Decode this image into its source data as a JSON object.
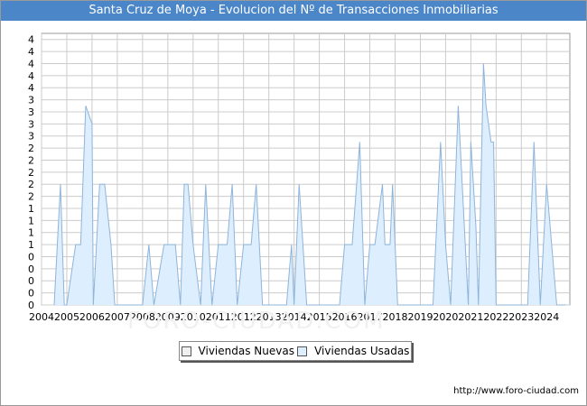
{
  "title": "Santa Cruz de Moya - Evolucion del Nº de Transacciones Inmobiliarias",
  "source": "http://www.foro-ciudad.com",
  "watermark": "FORO-CIUDAD.COM",
  "legend": {
    "nuevas_label": "Viviendas Nuevas",
    "usadas_label": "Viviendas Usadas"
  },
  "colors": {
    "title_bg": "#4a86c8",
    "nuevas_fill": "#f0f0f0",
    "usadas_fill": "#ddeeff",
    "usadas_stroke": "#8fb4d9",
    "grid": "#cccccc"
  },
  "chart_data": {
    "type": "area",
    "title": "Santa Cruz de Moya - Evolucion del Nº de Transacciones Inmobiliarias",
    "xlabel": "",
    "ylabel": "",
    "xlim": [
      2004,
      2024.92
    ],
    "ylim": [
      0,
      4.5
    ],
    "y_ticks": [
      0,
      0.2,
      0.4,
      0.6,
      0.8,
      1.0,
      1.2,
      1.4,
      1.6,
      1.8,
      2.0,
      2.2,
      2.4,
      2.6,
      2.8,
      3.0,
      3.2,
      3.4,
      3.6,
      3.8,
      4.0,
      4.2,
      4.4
    ],
    "y_tick_labels": [
      "0",
      "0",
      "0",
      "0",
      "0",
      "1",
      "1",
      "1",
      "1",
      "2",
      "2",
      "2",
      "2",
      "2",
      "3",
      "3",
      "3",
      "3",
      "4",
      "4",
      "4",
      "4",
      "4"
    ],
    "x_tick_labels": [
      "2004",
      "2005",
      "2006",
      "2007",
      "2008",
      "2009",
      "2010",
      "2011",
      "2012",
      "2013",
      "2014",
      "2015",
      "2016",
      "2017",
      "2018",
      "2019",
      "2020",
      "2021",
      "2022",
      "2023",
      "2024"
    ],
    "grid": true,
    "legend_position": "bottom-center",
    "series": [
      {
        "name": "Viviendas Nuevas",
        "x": [],
        "y": []
      },
      {
        "name": "Viviendas Usadas",
        "x": [
          2004.5,
          2004.75,
          2004.9,
          2005.0,
          2005.35,
          2005.55,
          2005.75,
          2006.0,
          2006.05,
          2006.3,
          2006.5,
          2006.75,
          2006.9,
          2007.1,
          2007.3,
          2008.0,
          2008.25,
          2008.45,
          2008.85,
          2009.0,
          2009.3,
          2009.5,
          2009.65,
          2009.8,
          2010.0,
          2010.3,
          2010.5,
          2010.75,
          2011.0,
          2011.25,
          2011.35,
          2011.55,
          2011.75,
          2012.0,
          2012.3,
          2012.5,
          2012.75,
          2012.95,
          2013.05,
          2013.7,
          2013.9,
          2014.0,
          2014.2,
          2014.5,
          2014.7,
          2015.8,
          2016.0,
          2016.3,
          2016.6,
          2016.8,
          2017.0,
          2017.2,
          2017.5,
          2017.6,
          2017.8,
          2017.9,
          2018.1,
          2018.3,
          2018.5,
          2018.7,
          2019.5,
          2019.8,
          2020.0,
          2020.2,
          2020.5,
          2020.9,
          2021.0,
          2021.2,
          2021.3,
          2021.5,
          2021.6,
          2021.8,
          2021.9,
          2022.0,
          2022.3,
          2022.5,
          2022.7,
          2022.9,
          2023.25,
          2023.5,
          2023.75,
          2024.0,
          2024.2,
          2024.4,
          2024.5,
          2024.75
        ],
        "y": [
          0,
          2.0,
          0,
          0,
          1.0,
          1.0,
          3.3,
          3.0,
          0,
          2.0,
          2.0,
          1.0,
          0,
          0,
          0,
          0,
          1.0,
          0,
          1.0,
          1.0,
          1.0,
          0,
          2.0,
          2.0,
          1.0,
          0,
          2.0,
          0,
          1.0,
          1.0,
          1.0,
          2.0,
          0,
          1.0,
          1.0,
          2.0,
          0,
          0,
          0,
          0,
          1.0,
          0,
          2.0,
          0,
          0,
          0,
          1.0,
          1.0,
          2.7,
          0,
          1.0,
          1.0,
          2.0,
          1.0,
          1.0,
          2.0,
          0,
          0,
          0,
          0,
          0,
          2.7,
          1.0,
          0,
          3.3,
          0,
          2.7,
          1.3,
          0,
          4.0,
          3.3,
          2.7,
          2.7,
          0,
          0,
          0,
          0,
          0,
          0,
          2.7,
          0,
          2.0,
          1.0,
          0,
          0,
          0
        ]
      }
    ]
  }
}
